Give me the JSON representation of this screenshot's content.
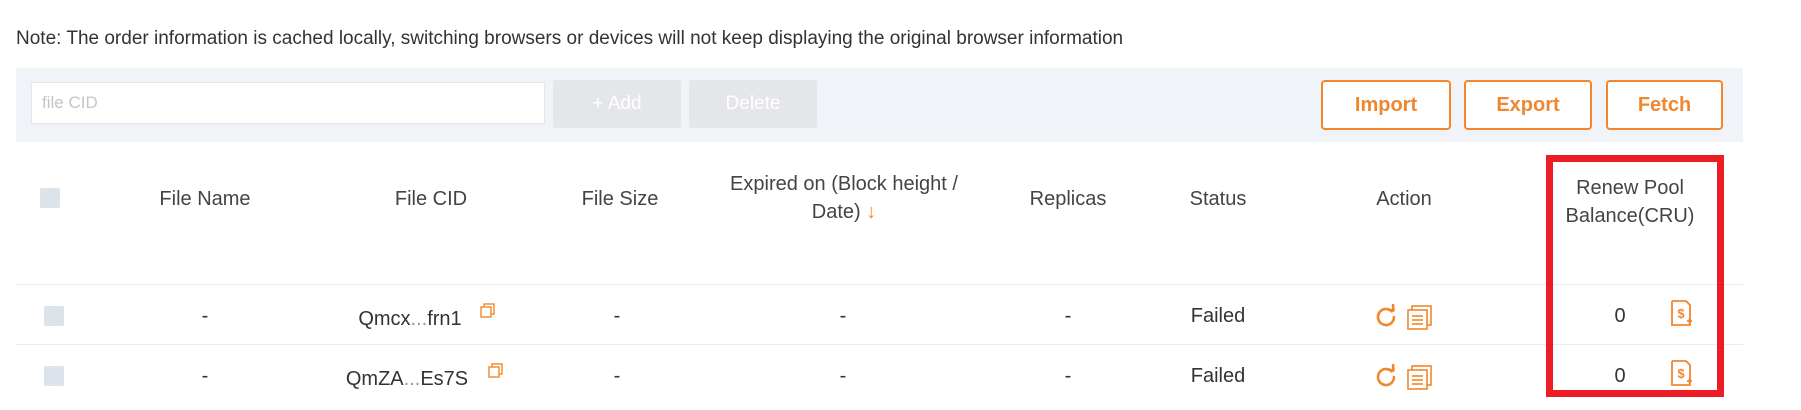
{
  "note": "Note: The order information is cached locally, switching browsers or devices will not keep displaying the original browser information",
  "toolbar": {
    "cid_placeholder": "file CID",
    "add_label": "+ Add",
    "delete_label": "Delete",
    "import_label": "Import",
    "export_label": "Export",
    "fetch_label": "Fetch"
  },
  "table": {
    "headers": {
      "file_name": "File Name",
      "file_cid": "File CID",
      "file_size": "File Size",
      "expired_line1": "Expired on (Block height /",
      "expired_line2": "Date)",
      "sort_arrow": "↓",
      "replicas": "Replicas",
      "status": "Status",
      "action": "Action",
      "renew_line1": "Renew Pool",
      "renew_line2": "Balance(CRU)"
    },
    "rows": [
      {
        "file_name": "-",
        "cid_head": "Qmcx",
        "cid_ellipsis": "...",
        "cid_tail": "frn1",
        "file_size": "-",
        "expired": "-",
        "replicas": "-",
        "status": "Failed",
        "balance": "0"
      },
      {
        "file_name": "-",
        "cid_head": "QmZA",
        "cid_ellipsis": "...",
        "cid_tail": "Es7S",
        "file_size": "-",
        "expired": "-",
        "replicas": "-",
        "status": "Failed",
        "balance": "0"
      }
    ]
  },
  "colors": {
    "accent": "#f0872e",
    "highlight_box": "#ee1c24",
    "toolbar_bg": "#f0f4f8"
  },
  "icons": {
    "copy": "copy-icon",
    "refresh": "refresh-icon",
    "details": "document-icon",
    "recharge": "recharge-icon"
  }
}
